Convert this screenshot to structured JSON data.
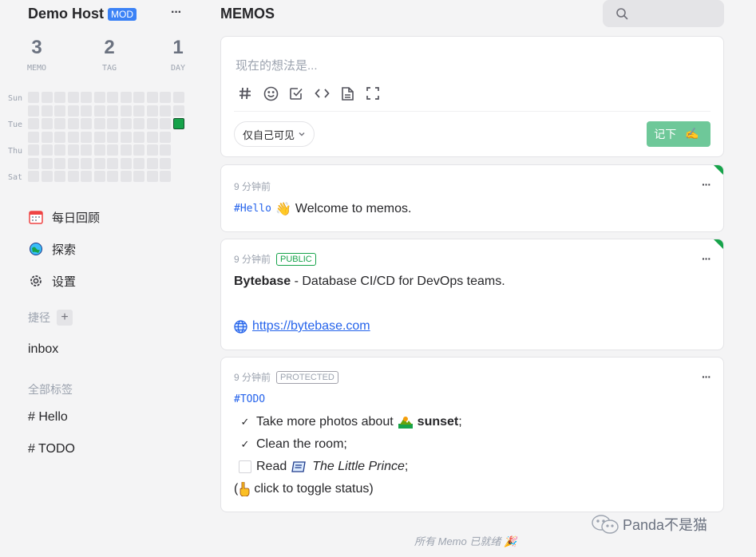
{
  "sidebar": {
    "user_name": "Demo Host",
    "role_badge": "MOD",
    "more_label": "···",
    "stats": [
      {
        "value": "3",
        "label": "MEMO"
      },
      {
        "value": "2",
        "label": "TAG"
      },
      {
        "value": "1",
        "label": "DAY"
      }
    ],
    "heatmap": {
      "day_labels": [
        "Sun",
        "Tue",
        "Thu",
        "Sat"
      ],
      "active_color": "#16a34a"
    },
    "nav": [
      {
        "label": "每日回顾",
        "icon": "calendar-icon"
      },
      {
        "label": "探索",
        "icon": "explore-icon"
      },
      {
        "label": "设置",
        "icon": "gear-icon"
      }
    ],
    "shortcuts_label": "捷径",
    "shortcut_items": [
      "inbox"
    ],
    "tags_label": "全部标签",
    "tags": [
      "# Hello",
      "# TODO"
    ]
  },
  "header": {
    "title": "MEMOS",
    "search_icon": "search-icon"
  },
  "editor": {
    "placeholder": "现在的想法是...",
    "visibility": "仅自己可见",
    "submit_label": "记下",
    "submit_emoji": "✍️"
  },
  "memos": [
    {
      "time": "9 分钟前",
      "tag": "#Hello",
      "text": "Welcome to memos.",
      "emoji": "👋"
    },
    {
      "time": "9 分钟前",
      "visibility": "PUBLIC",
      "title": "Bytebase",
      "text": " - Database CI/CD for DevOps teams.",
      "link": "https://bytebase.com"
    },
    {
      "time": "9 分钟前",
      "visibility": "PROTECTED",
      "tag": "#TODO",
      "todo_1_pre": "Take more photos about",
      "todo_1_bold": "sunset",
      "todo_1_post": ";",
      "todo_2": "Clean the room;",
      "todo_3_pre": "Read",
      "todo_3_italic": "The Little Prince",
      "todo_3_post": ";",
      "note_pre": "(",
      "note": "click to toggle status)"
    }
  ],
  "footer": "所有 Memo 已就绪 🎉",
  "watermark": "Panda不是猫",
  "colors": {
    "accent": "#16a34a",
    "submit": "#6ec899",
    "link": "#2563eb"
  }
}
